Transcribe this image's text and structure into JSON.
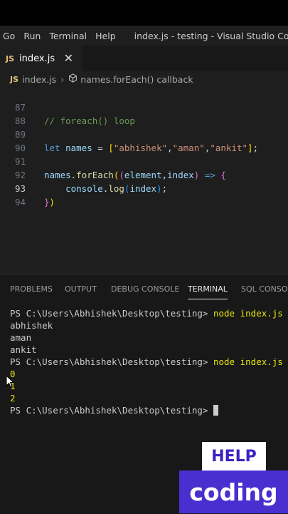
{
  "menubar": {
    "items": [
      "Go",
      "Run",
      "Terminal",
      "Help"
    ],
    "window_title": "index.js - testing - Visual Studio Code"
  },
  "tab": {
    "badge": "JS",
    "label": "index.js",
    "close": "✕"
  },
  "breadcrumb": {
    "badge": "JS",
    "file": "index.js",
    "symbol": "names.forEach() callback"
  },
  "editor": {
    "line_numbers": [
      "87",
      "88",
      "89",
      "90",
      "91",
      "92",
      "93",
      "94"
    ],
    "tokens": {
      "comment": "// foreach() loop",
      "let": "let",
      "names": "names",
      "eq": " = ",
      "lbracket": "[",
      "s1": "\"abhishek\"",
      "comma": ",",
      "s2": "\"aman\"",
      "s3": "\"ankit\"",
      "rbracket": "]",
      "semi": ";",
      "dot": ".",
      "forEach": "forEach",
      "lparen": "(",
      "element": "element",
      "index": "index",
      "arrow": " => ",
      "lbrace": "{",
      "indent": "    ",
      "console": "console",
      "log": "log",
      "rparen": ")",
      "rbrace": "}"
    }
  },
  "panel": {
    "tabs": [
      "PROBLEMS",
      "OUTPUT",
      "DEBUG CONSOLE",
      "TERMINAL",
      "SQL CONSOLE"
    ],
    "active_tab": "TERMINAL"
  },
  "terminal": {
    "prompt": "PS C:\\Users\\Abhishek\\Desktop\\testing> ",
    "command": "node index.js",
    "out1": [
      "abhishek",
      "aman",
      "ankit"
    ],
    "out2": [
      "0",
      "1",
      "2"
    ]
  },
  "watermark": {
    "top": "HELP",
    "bottom": "coding"
  }
}
